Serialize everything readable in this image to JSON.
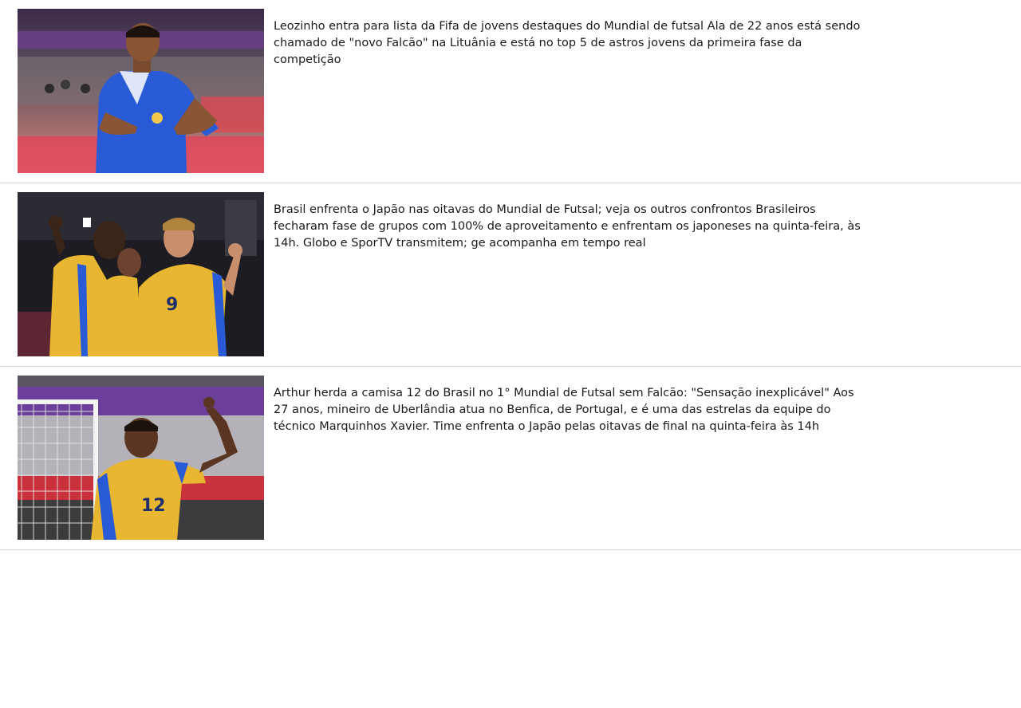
{
  "feed": {
    "items": [
      {
        "title": "Leozinho entra para lista da Fifa de jovens destaques do Mundial de futsal",
        "summary": "Ala de 22 anos está sendo chamado de \"novo Falcão\" na Lituânia e está no top 5 de astros jovens da primeira fase da competição",
        "image": "photo-player-blue-jersey",
        "image_alt": "Leozinho com a camisa azul do Brasil"
      },
      {
        "title": "Brasil enfrenta o Japão nas oitavas do Mundial de Futsal; veja os outros confrontos",
        "summary": "Brasileiros fecharam fase de grupos com 100% de aproveitamento e enfrentam os japoneses na quinta-feira, às 14h. Globo e SporTV transmitem; ge acompanha em tempo real",
        "image": "photo-team-celebration-yellow-jersey",
        "image_alt": "Jogadores do Brasil comemorando"
      },
      {
        "title": "Arthur herda a camisa 12 do Brasil no 1° Mundial de Futsal sem Falcão: \"Sensação inexplicável\"",
        "summary": "Aos 27 anos, mineiro de Uberlândia atua no Benfica, de Portugal, e é uma das estrelas da equipe do técnico Marquinhos Xavier. Time enfrenta o Japão pelas oitavas de final na quinta-feira às 14h",
        "image": "photo-player-pointing-up-number-12",
        "image_alt": "Arthur apontando para o céu"
      }
    ]
  },
  "colors": {
    "divider": "#d6d6d6",
    "text": "#1a1a1a",
    "brazil_blue": "#2a5bd7",
    "brazil_yellow": "#f2b632"
  }
}
